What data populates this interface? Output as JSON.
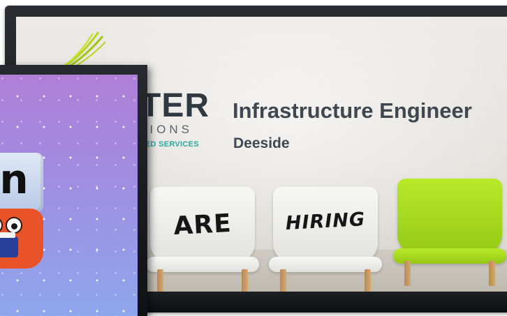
{
  "back_screen": {
    "logo": {
      "word": "TER",
      "sub": "TIONS",
      "tag": "GED SERVICES",
      "icon": "swoosh-logo-icon"
    },
    "job_title": "Infrastructure Engineer",
    "job_location": "Deeside",
    "chairs": [
      {
        "color": "white",
        "text": "ARE"
      },
      {
        "color": "white",
        "text": "HIRING"
      },
      {
        "color": "green",
        "text": ""
      }
    ]
  },
  "front_screen": {
    "letter": "n",
    "character": "reading-character-icon"
  },
  "colors": {
    "logo_teal": "#29a8a0",
    "title_gray": "#3f4750",
    "chair_green": "#a6d91f",
    "front_bg_top": "#b07fd6",
    "front_bg_bottom": "#8ea6ee"
  }
}
